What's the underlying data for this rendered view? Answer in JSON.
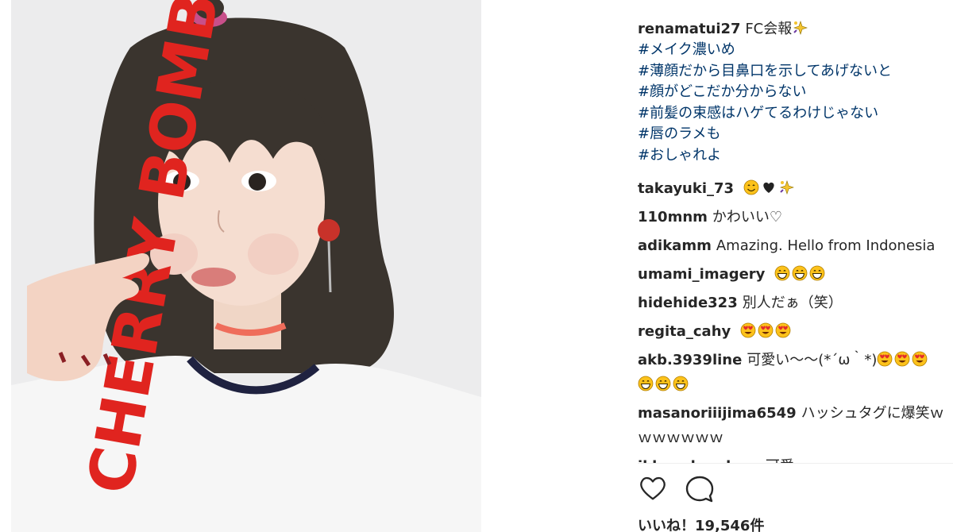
{
  "post": {
    "author": "renamatui27",
    "caption_text": "FC会報",
    "caption_emoji": "sparkles-icon",
    "hashtags": [
      "#メイク濃いめ",
      "#薄顔だから目鼻口を示してあげないと",
      "#顔がどこだか分からない",
      "#前髪の束感はハゲてるわけじゃない",
      "#唇のラメも",
      "#おしゃれよ"
    ],
    "photo_shirt_text": "CHERRY BOMB"
  },
  "comments": [
    {
      "user": "takayuki_73",
      "text": "",
      "emojis": [
        "smiling-face-icon",
        "black-heart-icon",
        "sparkles-icon"
      ]
    },
    {
      "user": "110mnm",
      "text": "かわいい♡",
      "emojis": []
    },
    {
      "user": "adikamm",
      "text": "Amazing. Hello from Indonesia",
      "emojis": []
    },
    {
      "user": "umami_imagery",
      "text": "",
      "emojis": [
        "grinning-face-icon",
        "grinning-face-icon",
        "grinning-face-icon"
      ]
    },
    {
      "user": "hidehide323",
      "text": "別人だぁ（笑）",
      "emojis": []
    },
    {
      "user": "regita_cahy",
      "text": "",
      "emojis": [
        "heart-eyes-icon",
        "heart-eyes-icon",
        "heart-eyes-icon"
      ]
    },
    {
      "user": "akb.3939line",
      "text": "可愛い〜〜(*´ω｀*)",
      "emojis": [
        "heart-eyes-icon",
        "heart-eyes-icon",
        "heart-eyes-icon",
        "grinning-face-icon",
        "grinning-face-icon",
        "grinning-face-icon"
      ]
    },
    {
      "user": "masanoriiijima6549",
      "text": "ハッシュタグに爆笑ｗｗｗｗｗｗｗ",
      "emojis": []
    },
    {
      "user": "ikhsanhandono",
      "text": "可愛",
      "emojis": []
    }
  ],
  "actions": {
    "like_icon": "heart-outline-icon",
    "comment_icon": "comment-bubble-icon"
  },
  "likes": {
    "label": "いいね！",
    "count": "19,546件"
  },
  "colors": {
    "text": "#262626",
    "hashtag": "#003569",
    "shirt_red": "#e0241f",
    "divider": "#efefef"
  }
}
